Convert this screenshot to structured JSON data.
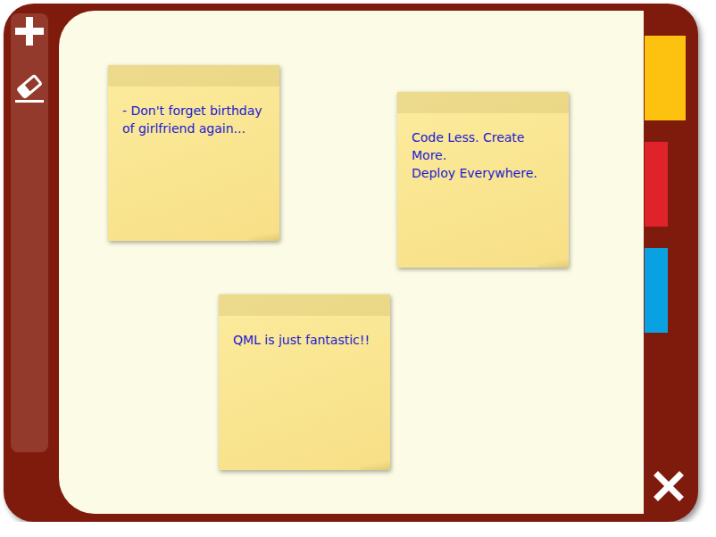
{
  "notes": [
    {
      "text": "- Don't forget birthday\nof girlfriend again..."
    },
    {
      "text": "Code Less. Create More.\nDeploy Everywhere."
    },
    {
      "text": "QML is just fantastic!!"
    }
  ],
  "tabs": [
    {
      "color": "#fdc20f",
      "selected": true
    },
    {
      "color": "#e0232b",
      "selected": false
    },
    {
      "color": "#0aa1e2",
      "selected": false
    }
  ]
}
